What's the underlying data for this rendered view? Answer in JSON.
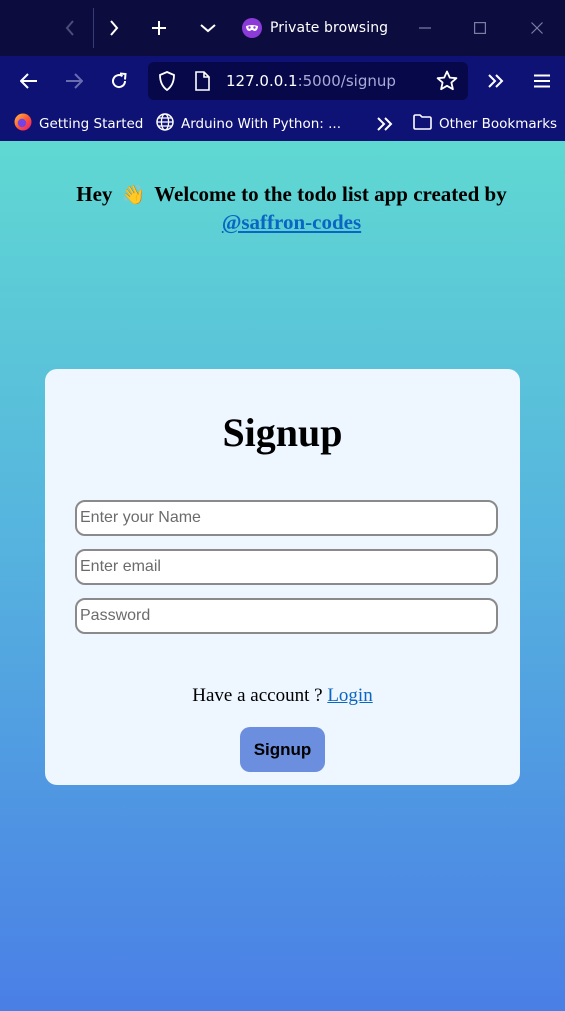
{
  "browser": {
    "private_label": "Private browsing",
    "url_host": "127.0.0.1",
    "url_path": ":5000/signup",
    "bookmarks": [
      {
        "label": "Getting Started",
        "icon": "firefox-icon"
      },
      {
        "label": "Arduino With Python: ...",
        "icon": "globe-icon"
      }
    ],
    "other_bookmarks": "Other Bookmarks"
  },
  "page": {
    "welcome_prefix": "Hey",
    "wave_emoji": "👋",
    "welcome_text": "Welcome to the todo list app created by",
    "author_link": "@saffron-codes",
    "form": {
      "title": "Signup",
      "name_placeholder": "Enter your Name",
      "email_placeholder": "Enter email",
      "password_placeholder": "Password",
      "have_account_text": "Have a account ?",
      "login_link": "Login",
      "submit_label": "Signup"
    }
  },
  "colors": {
    "tabbar_bg": "#0d0c3f",
    "toolbar_bg": "#0f1275",
    "gradient_top": "#5fd8d2",
    "gradient_bottom": "#4a7fe6",
    "card_bg": "#eef6ff",
    "button_bg": "#6b8ede",
    "link": "#0a66c2"
  }
}
